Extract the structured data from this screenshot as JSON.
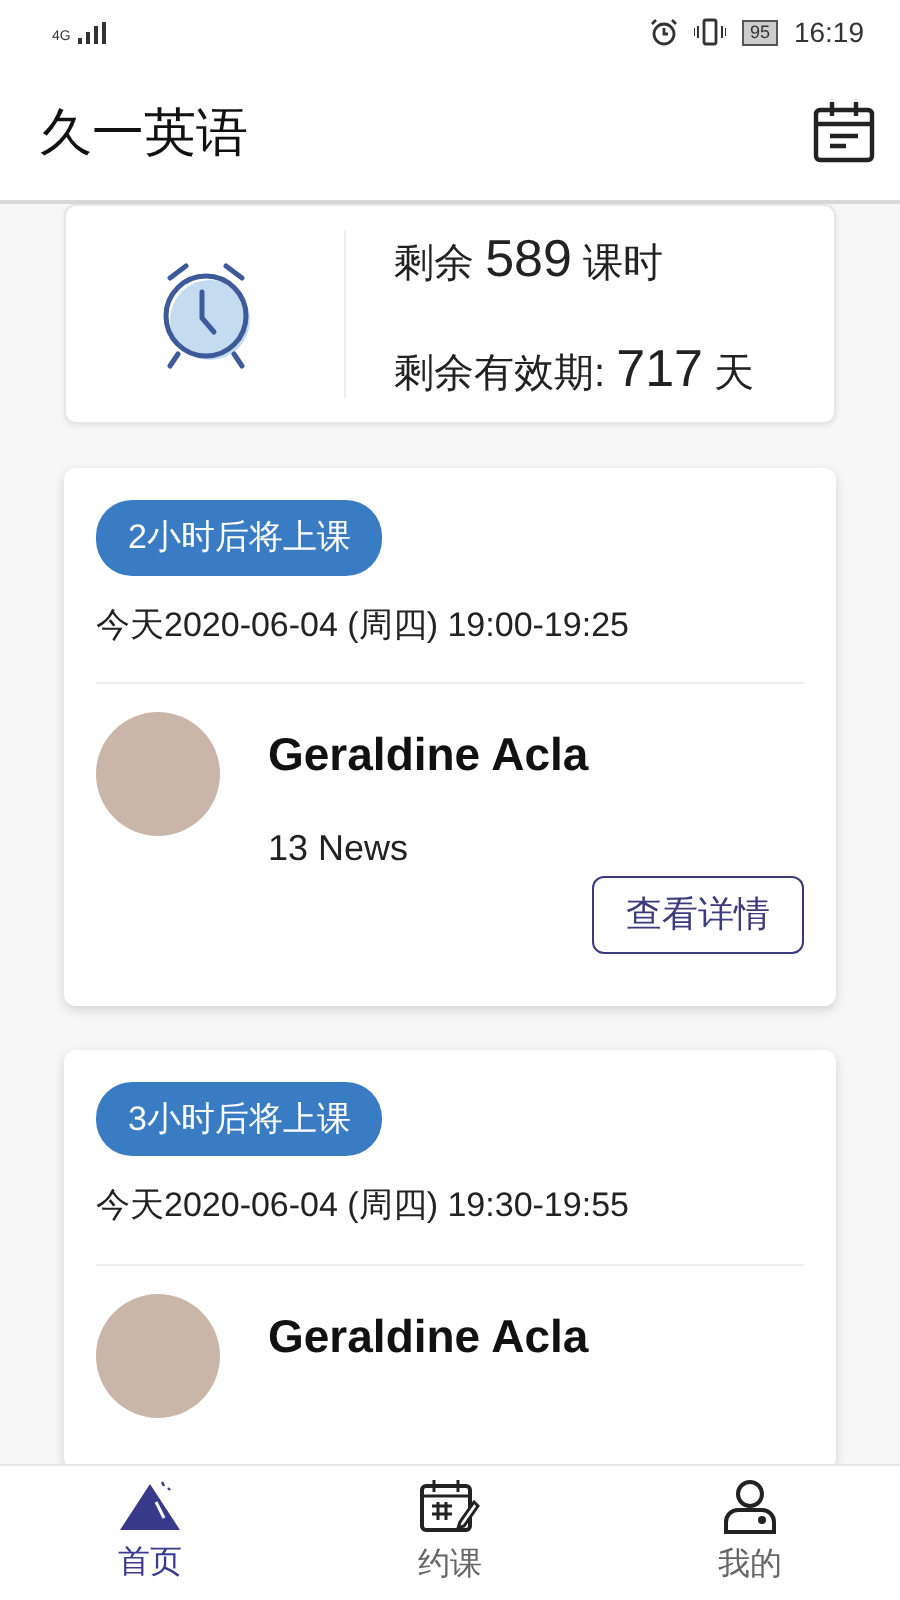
{
  "status_bar": {
    "network": "4G",
    "battery": "95",
    "time": "16:19"
  },
  "header": {
    "title": "久一英语"
  },
  "summary": {
    "lines": [
      {
        "prefix": "剩余",
        "value": "589",
        "unit": "课时"
      },
      {
        "prefix": "剩余有效期:",
        "value": "717",
        "unit": "天"
      }
    ]
  },
  "lessons": [
    {
      "badge": "2小时后将上课",
      "datetime": "今天2020-06-04 (周四) 19:00-19:25",
      "teacher": "Geraldine Acla",
      "credits": "13 News",
      "button": "查看详情"
    },
    {
      "badge": "3小时后将上课",
      "datetime": "今天2020-06-04 (周四) 19:30-19:55",
      "teacher": "Geraldine Acla"
    }
  ],
  "tabs": [
    {
      "label": "首页",
      "kind": "home",
      "selected": true
    },
    {
      "label": "约课",
      "kind": "schedule",
      "selected": false
    },
    {
      "label": "我的",
      "kind": "profile",
      "selected": false
    }
  ]
}
